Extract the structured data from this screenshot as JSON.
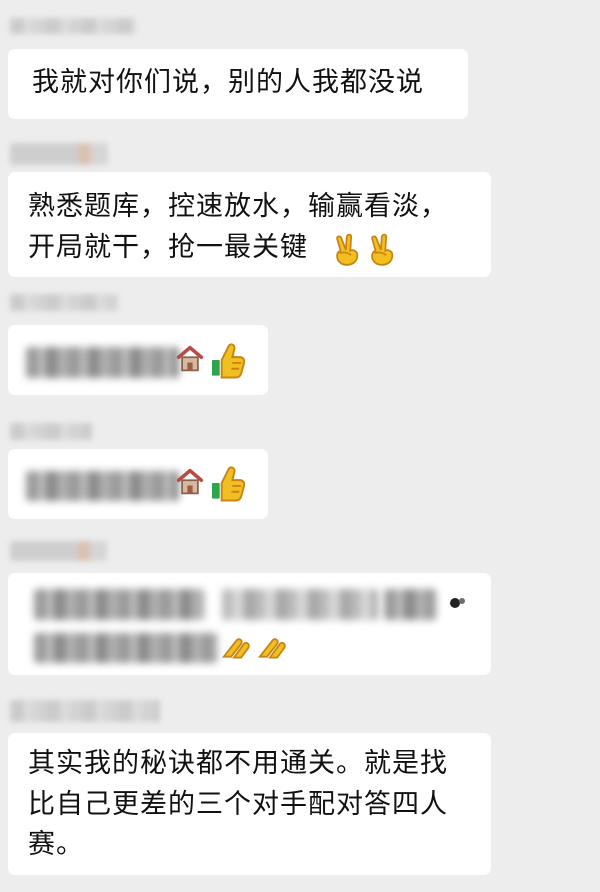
{
  "messages": [
    {
      "text": "我就对你们说，别的人我都没说"
    },
    {
      "line_1": "熟悉题库，控速放水，输赢看淡，",
      "line_2": "开局就干，抢一最关键"
    },
    {},
    {},
    {},
    {
      "line_1": "其实我的秘诀都不用通关。就是找",
      "line_2": "比自己更差的三个对手配对答四人",
      "line_3": "赛。"
    }
  ],
  "colors": {
    "background": "#ededed",
    "bubble": "#ffffff",
    "text": "#111111",
    "emoji_yellow": "#f2bf22",
    "house_red": "#b84b42"
  },
  "icons": [
    "victory-hand-emoji",
    "thumbs-up-emoji",
    "house-emoji",
    "clapping-hands-emoji"
  ]
}
